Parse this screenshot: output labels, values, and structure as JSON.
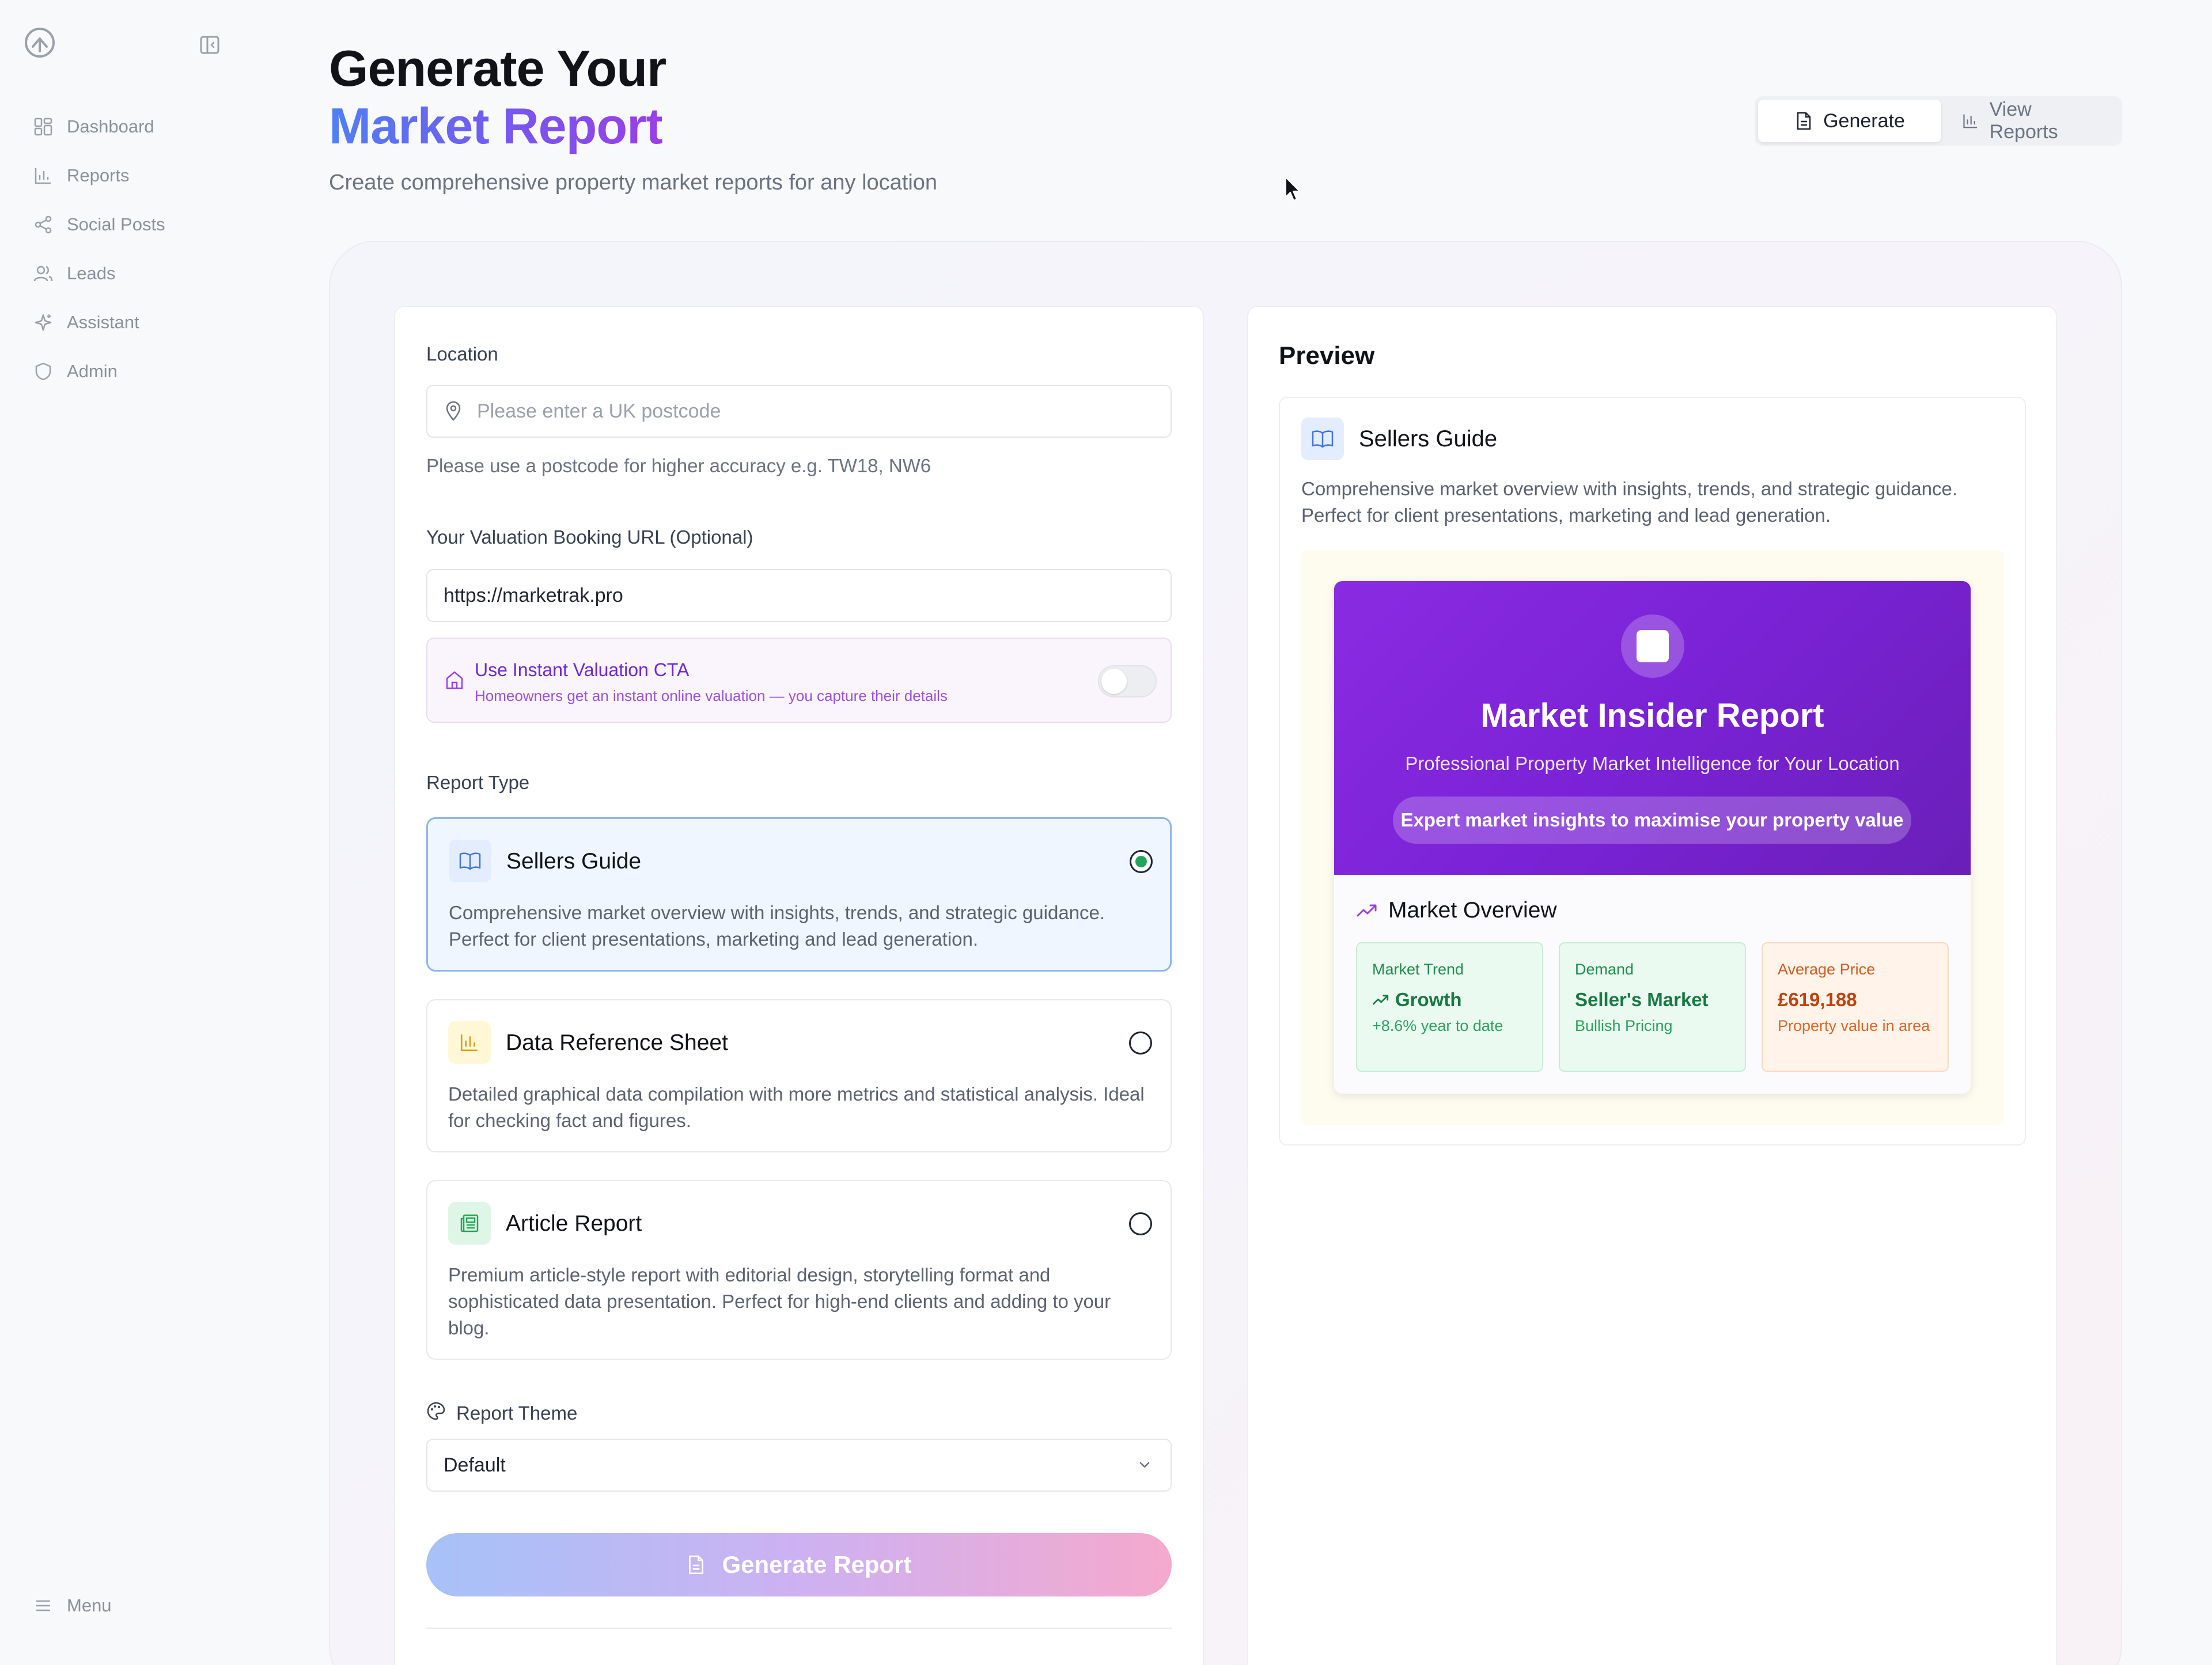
{
  "sidebar": {
    "items": [
      {
        "label": "Dashboard",
        "icon": "grid-icon"
      },
      {
        "label": "Reports",
        "icon": "bar-chart-icon"
      },
      {
        "label": "Social Posts",
        "icon": "share-icon"
      },
      {
        "label": "Leads",
        "icon": "users-icon"
      },
      {
        "label": "Assistant",
        "icon": "sparkle-icon"
      },
      {
        "label": "Admin",
        "icon": "shield-icon"
      }
    ],
    "menu_label": "Menu"
  },
  "header": {
    "title_line1": "Generate Your",
    "title_line2": "Market Report",
    "subtitle": "Create comprehensive property market reports for any location",
    "tabs": [
      {
        "label": "Generate",
        "active": true
      },
      {
        "label": "View Reports",
        "active": false
      }
    ]
  },
  "form": {
    "location_label": "Location",
    "location_placeholder": "Please enter a UK postcode",
    "location_hint": "Please use a postcode for higher accuracy e.g. TW18, NW6",
    "url_label": "Your Valuation Booking URL (Optional)",
    "url_value": "https://marketrak.pro",
    "cta": {
      "title": "Use Instant Valuation CTA",
      "subtitle": "Homeowners get an instant online valuation — you capture their details",
      "enabled": false
    },
    "report_type_label": "Report Type",
    "report_types": [
      {
        "title": "Sellers Guide",
        "desc": "Comprehensive market overview with insights, trends, and strategic guidance. Perfect for client presentations, marketing and lead generation.",
        "selected": true,
        "icon": "book-icon"
      },
      {
        "title": "Data Reference Sheet",
        "desc": "Detailed graphical data compilation with more metrics and statistical analysis. Ideal for checking fact and figures.",
        "selected": false,
        "icon": "bar-chart-icon"
      },
      {
        "title": "Article Report",
        "desc": "Premium article-style report with editorial design, storytelling format and sophisticated data presentation. Perfect for high-end clients and adding to your blog.",
        "selected": false,
        "icon": "newspaper-icon"
      }
    ],
    "theme_label": "Report Theme",
    "theme_value": "Default",
    "generate_button": "Generate Report"
  },
  "preview": {
    "heading": "Preview",
    "type_title": "Sellers Guide",
    "type_desc": "Comprehensive market overview with insights, trends, and strategic guidance. Perfect for client presentations, marketing and lead generation.",
    "report": {
      "title": "Market Insider Report",
      "subtitle": "Professional Property Market Intelligence for Your Location",
      "pill": "Expert market insights to maximise your property value",
      "overview_title": "Market Overview",
      "stats": [
        {
          "label": "Market Trend",
          "value": "Growth",
          "sub": "+8.6% year to date"
        },
        {
          "label": "Demand",
          "value": "Seller's Market",
          "sub": "Bullish Pricing"
        },
        {
          "label": "Average Price",
          "value": "£619,188",
          "sub": "Property value in area"
        }
      ]
    }
  },
  "colors": {
    "accent_purple": "#7a22d6",
    "title_gradient_start": "#4f7ff5",
    "title_gradient_end": "#9b3ee6",
    "selected_radio": "#22a55a"
  }
}
